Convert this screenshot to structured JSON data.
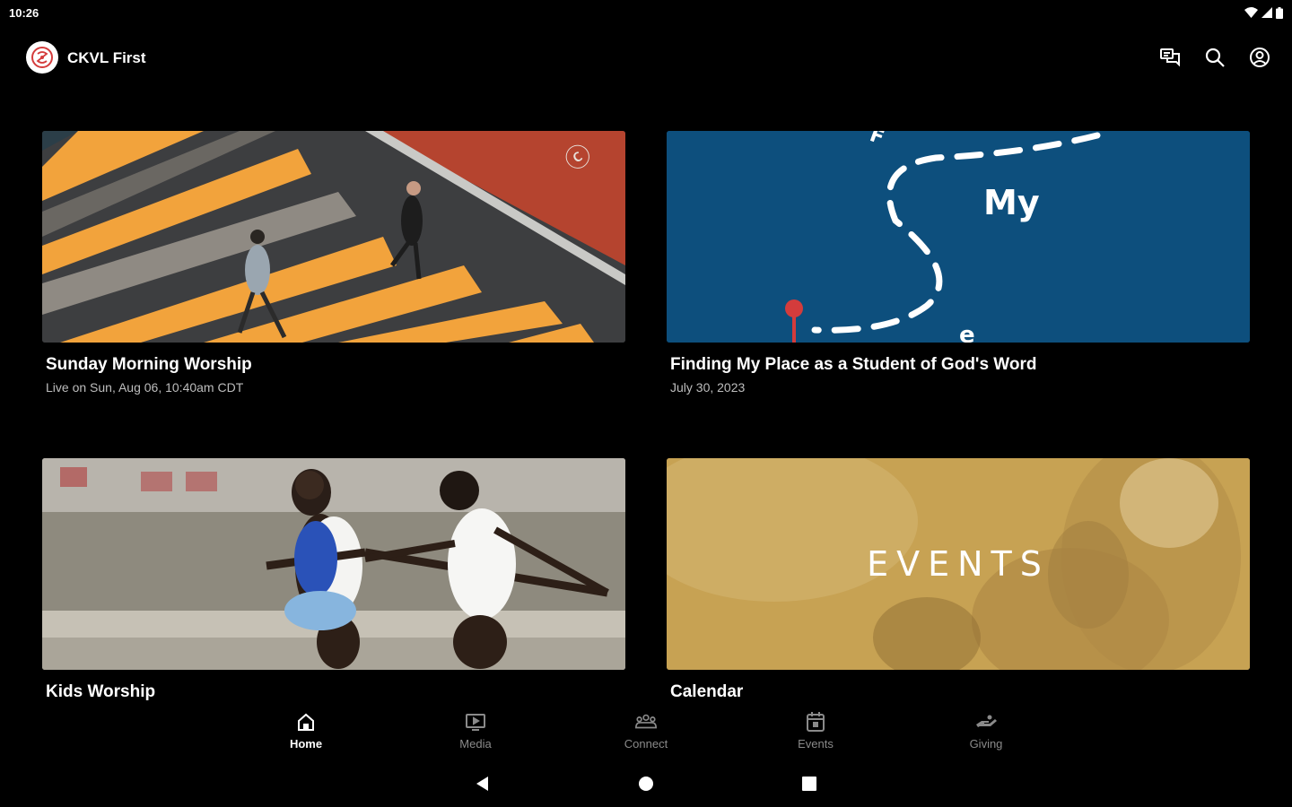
{
  "status_bar": {
    "time": "10:26",
    "icons": [
      "wifi-icon",
      "signal-icon",
      "battery-icon"
    ]
  },
  "app_bar": {
    "title": "CKVL First",
    "logo": "church-logo",
    "actions": [
      "chat-icon",
      "search-icon",
      "account-icon"
    ]
  },
  "cards": [
    {
      "title": "Sunday Morning Worship",
      "subtitle": "Live on Sun, Aug 06, 10:40am CDT",
      "image": "street-crosswalk-photo"
    },
    {
      "title": "Finding My Place as a Student of God's Word",
      "subtitle": "July 30, 2023",
      "image": "blue-dashed-path-graphic",
      "image_text": "My"
    },
    {
      "title": "Kids Worship",
      "image": "running-kids-photo"
    },
    {
      "title": "Calendar",
      "image": "events-graphic",
      "image_text": "EVENTS"
    }
  ],
  "bottom_nav": {
    "items": [
      {
        "label": "Home",
        "icon": "home-icon",
        "active": true
      },
      {
        "label": "Media",
        "icon": "tv-icon",
        "active": false
      },
      {
        "label": "Connect",
        "icon": "groups-icon",
        "active": false
      },
      {
        "label": "Events",
        "icon": "calendar-icon",
        "active": false
      },
      {
        "label": "Giving",
        "icon": "giving-hand-icon",
        "active": false
      }
    ]
  },
  "system_nav": [
    "back-icon",
    "home-circle-icon",
    "recents-square-icon"
  ],
  "colors": {
    "background": "#000000",
    "accent": "#d43c3c",
    "blue_card": "#0d4f7d",
    "events_gold": "#c4a050",
    "inactive_nav": "#8a8a8a"
  }
}
